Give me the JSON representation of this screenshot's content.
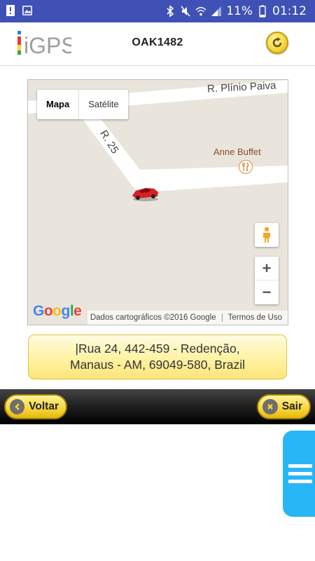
{
  "status_bar": {
    "battery_percent": "11%",
    "time": "01:12",
    "background_color": "#3f51b5"
  },
  "header": {
    "logo_text": "iGPS",
    "title": "OAK1482",
    "refresh_icon": "refresh-icon"
  },
  "map": {
    "map_type_options": [
      "Mapa",
      "Satélite"
    ],
    "selected_map_type": "Mapa",
    "streets": [
      "R. Plínio Paiva",
      "R. 25"
    ],
    "poi": {
      "name": "Anne Buffet",
      "icon": "restaurant-icon"
    },
    "vehicle_icon": "car-icon",
    "zoom_in": "+",
    "zoom_out": "−",
    "google_logo": "Google",
    "attribution": "Dados cartográficos ©2016 Google",
    "terms": "Termos de Uso"
  },
  "address": {
    "line1": "|Rua 24, 442-459 - Redenção,",
    "line2": "Manaus - AM, 69049-580, Brazil"
  },
  "bottom_bar": {
    "back_label": "Voltar",
    "exit_label": "Sair"
  },
  "drawer": {
    "icon": "menu-icon",
    "color": "#29b6f6"
  }
}
